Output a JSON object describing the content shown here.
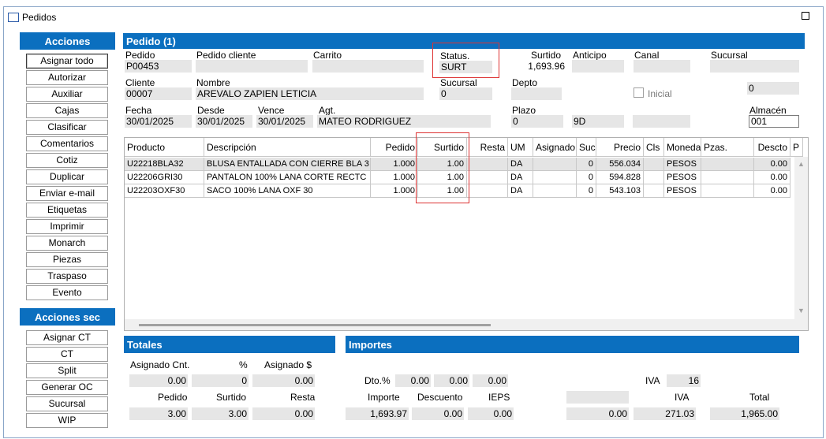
{
  "window": {
    "title": "Pedidos"
  },
  "acciones": {
    "header": "Acciones",
    "buttons": [
      "Asignar todo",
      "Autorizar",
      "Auxiliar",
      "Cajas",
      "Clasificar",
      "Comentarios",
      "Cotiz",
      "Duplicar",
      "Enviar e-mail",
      "Etiquetas",
      "Imprimir",
      "Monarch",
      "Piezas",
      "Traspaso",
      "Evento"
    ]
  },
  "acciones_sec": {
    "header": "Acciones sec",
    "buttons": [
      "Asignar CT",
      "CT",
      "Split",
      "Generar OC",
      "Sucursal",
      "WIP"
    ]
  },
  "pedido": {
    "header": "Pedido (1)",
    "labels": {
      "pedido": "Pedido",
      "pedido_cliente": "Pedido cliente",
      "carrito": "Carrito",
      "status": "Status.",
      "surtido": "Surtido",
      "anticipo": "Anticipo",
      "canal": "Canal",
      "sucursal": "Sucursal",
      "cliente": "Cliente",
      "nombre": "Nombre",
      "sucursal2": "Sucursal",
      "depto": "Depto",
      "inicial": "Inicial",
      "fecha": "Fecha",
      "desde": "Desde",
      "vence": "Vence",
      "agt": "Agt.",
      "plazo": "Plazo",
      "almacen": "Almacén"
    },
    "values": {
      "pedido": "P00453",
      "pedido_cliente": "",
      "carrito": "",
      "status": "SURT",
      "surtido": "1,693.96",
      "anticipo": "",
      "canal": "",
      "sucursal": "",
      "cliente": "00007",
      "nombre": "AREVALO ZAPIEN LETICIA",
      "sucursal2": "0",
      "depto": "",
      "right_val": "0",
      "fecha": "30/01/2025",
      "desde": "30/01/2025",
      "vence": "30/01/2025",
      "agt": "MATEO RODRIGUEZ",
      "plazo": "0",
      "plazo2": "9D",
      "plazo3": "",
      "almacen": "001"
    }
  },
  "table": {
    "columns": [
      "Producto",
      "Descripción",
      "Pedido",
      "Surtido",
      "Resta",
      "UM",
      "Asignado",
      "Suc.",
      "Precio",
      "Cls",
      "Moneda",
      "Pzas.",
      "Descto",
      "P"
    ],
    "rows": [
      [
        "U22218BLA32",
        "BLUSA ENTALLADA CON CIERRE BLA 3",
        "1.000",
        "1.00",
        "",
        "DA",
        "",
        "0",
        "556.034",
        "",
        "PESOS",
        "",
        "0.00"
      ],
      [
        "U22206GRI30",
        "PANTALON 100% LANA  CORTE RECTC",
        "1.000",
        "1.00",
        "",
        "DA",
        "",
        "0",
        "594.828",
        "",
        "PESOS",
        "",
        "0.00"
      ],
      [
        "U22203OXF30",
        "SACO 100% LANA OXF 30",
        "1.000",
        "1.00",
        "",
        "DA",
        "",
        "0",
        "543.103",
        "",
        "PESOS",
        "",
        "0.00"
      ]
    ]
  },
  "totales": {
    "header": "Totales",
    "labels": {
      "asignado_cnt": "Asignado Cnt.",
      "pct": "%",
      "asignado_usd": "Asignado $",
      "pedido": "Pedido",
      "surtido": "Surtido",
      "resta": "Resta"
    },
    "values": {
      "asignado_cnt": "0.00",
      "pct": "0",
      "asignado_usd": "0.00",
      "pedido": "3.00",
      "surtido": "3.00",
      "resta": "0.00"
    }
  },
  "importes": {
    "header": "Importes",
    "labels": {
      "dto": "Dto.%",
      "iva_top": "IVA",
      "importe": "Importe",
      "descuento": "Descuento",
      "ieps": "IEPS",
      "iva": "IVA",
      "total": "Total"
    },
    "values": {
      "dto1": "0.00",
      "dto2": "0.00",
      "dto3": "0.00",
      "iva_rate": "16",
      "importe": "1,693.97",
      "descuento": "0.00",
      "ieps": "0.00",
      "blank": "",
      "other": "0.00",
      "iva": "271.03",
      "total": "1,965.00"
    }
  }
}
